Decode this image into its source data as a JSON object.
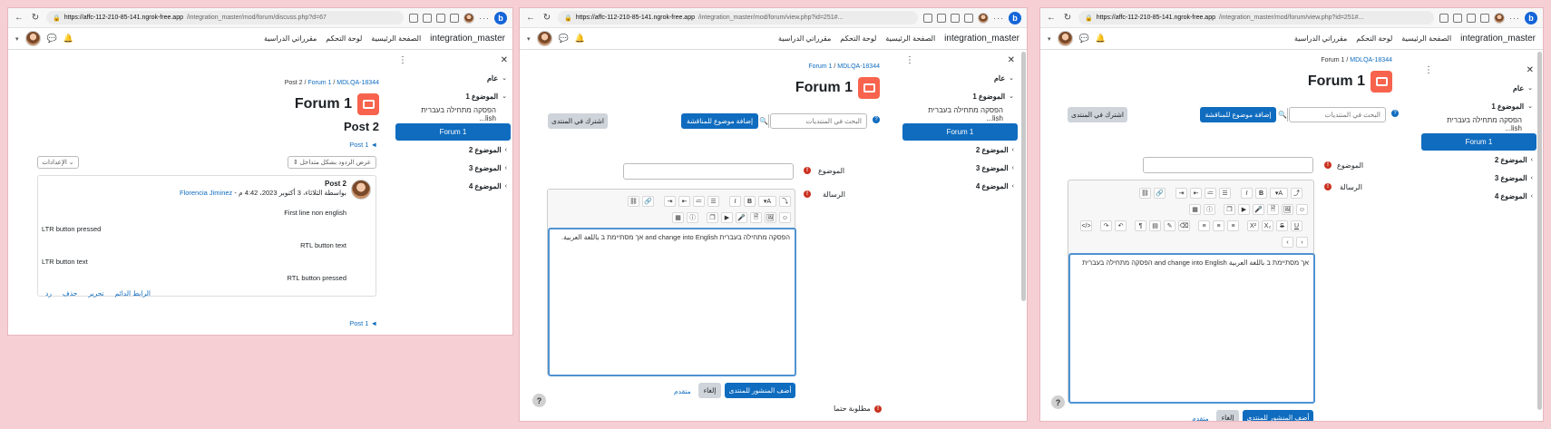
{
  "browser": {
    "url1_domain": "https://affc-112-210-85-141.ngrok-free.app",
    "url1_path": "/integration_master/mod/forum/discuss.php?d=67",
    "url2_domain": "https://affc-112-210-85-141.ngrok-free.app",
    "url2_path": "/integration_master/mod/forum/view.php?id=251#...",
    "url3_domain": "https://affc-112-210-85-141.ngrok-free.app",
    "url3_path": "/integration_master/mod/forum/view.php?id=251#...",
    "bing_label": "b"
  },
  "navbar": {
    "site_name": "integration_master",
    "home": "الصفحة الرئيسية",
    "dashboard": "لوحة التحكم",
    "my_courses": "مقرراتي الدراسية"
  },
  "drawer": {
    "general": "عام",
    "topic1": "الموضوع 1",
    "sub_item": "הפסקה מתחילה בעברית  lish...",
    "forum1": "Forum 1",
    "topic2": "الموضوع 2",
    "topic3": "الموضوع 3",
    "topic4": "الموضوع 4"
  },
  "win1": {
    "breadcrumb_mdl": "MDLQA-18344",
    "breadcrumb_forum": "Forum 1",
    "breadcrumb_post": "Post 2",
    "forum_title": "Forum 1",
    "post_heading": "Post 2",
    "nav_post1_top": "Post 1 ◄",
    "display_mode": "عرض الردود بشكل متداخل",
    "settings": "الإعدادات",
    "post_subject": "Post 2",
    "post_meta": "بواسطة الثلاثاء، 3 أكتوبر 2023، 4:42 م - ",
    "post_author": "Florencia Jiminez",
    "lines": [
      "First line non english",
      "LTR button pressed",
      "RTL button text",
      "LTR button text",
      "RTL button pressed"
    ],
    "actions": [
      "الرابط الدائم",
      "تحرير",
      "حذف",
      "رد"
    ],
    "nav_post1_bottom": "Post 1 ◄"
  },
  "forum_page": {
    "breadcrumb_mdl": "MDLQA-18344",
    "breadcrumb_forum": "Forum 1",
    "forum_title": "Forum 1",
    "search_placeholder": "البحث في المنتديات",
    "add_topic": "إضافة موضوع للمناقشة",
    "subscribe": "اشترك في المنتدى",
    "subject_label": "الموضوع",
    "message_label": "الرسالة",
    "editor_text_w2": "הפסקה מתחילה בעברית and change into English אך מסתיימת ב باللغة العربية.",
    "editor_text_w3": "אך מסתיימת ב باللغة العربية and change into English הפסקה מתחילה בעברית",
    "post_to_forum": "أضف المنشور للمنتدى",
    "cancel": "إلغاء",
    "advanced": "متقدم",
    "required": "مطلوبة حتما",
    "help": "?"
  }
}
